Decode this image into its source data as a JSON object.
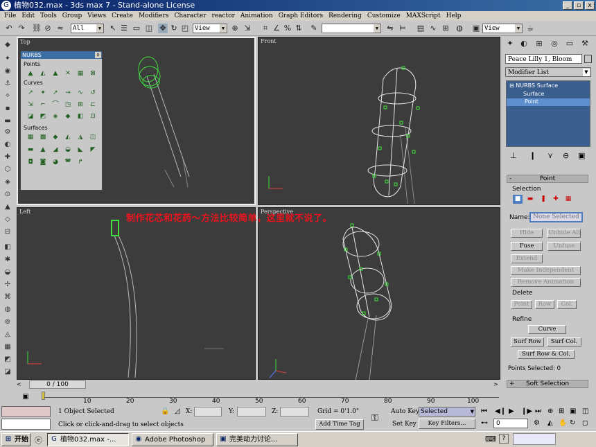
{
  "window": {
    "title": "植物032.max - 3ds max 7 - Stand-alone License",
    "controls": [
      "_",
      "▫",
      "x"
    ]
  },
  "menu": [
    "File",
    "Edit",
    "Tools",
    "Group",
    "Views",
    "Create",
    "Modifiers",
    "Character",
    "reactor",
    "Animation",
    "Graph Editors",
    "Rendering",
    "Customize",
    "MAXScript",
    "Help"
  ],
  "toolbar": {
    "selection_filter": "All",
    "ref_coord": "View",
    "named_selection": "",
    "render_view": "View"
  },
  "viewports": {
    "top": "Top",
    "front": "Front",
    "left": "Left",
    "perspective": "Perspective"
  },
  "nurbs_panel": {
    "title": "NURBS",
    "points": "Points",
    "curves": "Curves",
    "surfaces": "Surfaces"
  },
  "overlay_text": "制作花芯和花药～方法比较简单，这里就不说了。",
  "command_panel": {
    "object_name": "Peace Lilly 1, Bloom",
    "modifier_list": "Modifier List",
    "stack": [
      "NURBS Surface",
      "Surface",
      "Point"
    ],
    "point_rollout": "Point",
    "selection_label": "Selection",
    "name_label": "Name:",
    "name_value": "None Selected",
    "buttons": {
      "hide": "Hide",
      "unhide_all": "Unhide All",
      "fuse": "Fuse",
      "unfuse": "Unfuse",
      "extend": "Extend",
      "make_independent": "Make Independent",
      "remove_animation": "Remove Animation"
    },
    "delete_label": "Delete",
    "delete_buttons": [
      "Point",
      "Row",
      "Col."
    ],
    "refine_label": "Refine",
    "refine_buttons": {
      "curve": "Curve",
      "surf_row": "Surf Row",
      "surf_col": "Surf Col.",
      "surf_row_col": "Surf Row & Col."
    },
    "points_selected": "Points Selected: 0",
    "soft_selection": "Soft Selection"
  },
  "timeline": {
    "frame": "0 / 100",
    "ticks": [
      "10",
      "20",
      "30",
      "40",
      "50",
      "60",
      "70",
      "80",
      "90",
      "100"
    ]
  },
  "status": {
    "selected": "1 Object Selected",
    "prompt": "Click or click-and-drag to select objects",
    "x_label": "X:",
    "y_label": "Y:",
    "z_label": "Z:",
    "grid": "Grid = 0'1.0\"",
    "add_time_tag": "Add Time Tag",
    "auto_key": "Auto Key",
    "set_key": "Set Key",
    "key_mode": "Selected",
    "key_filters": "Key Filters...",
    "frame_field": "0"
  },
  "taskbar": {
    "start": "开始",
    "tasks": [
      "植物032.max -...",
      "Adobe Photoshop",
      "完美动力讨论..."
    ]
  }
}
